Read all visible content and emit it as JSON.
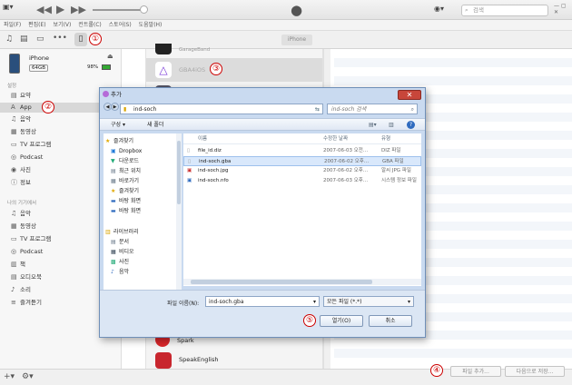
{
  "toolbar": {
    "search_placeholder": "검색"
  },
  "menubar": {
    "items": [
      "파일(F)",
      "편집(E)",
      "보기(V)",
      "컨트롤(C)",
      "스토어(S)",
      "도움말(H)"
    ]
  },
  "tabbar": {
    "device_tab": "iPhone",
    "annotation": "①"
  },
  "device": {
    "name": "iPhone",
    "capacity": "64GB",
    "battery": "98%"
  },
  "sidebar": {
    "settings_header": "설정",
    "settings_items": [
      "요약",
      "App",
      "음악",
      "동영상",
      "TV 프로그램",
      "Podcast",
      "사진",
      "정보"
    ],
    "device_header": "나의 기기에서",
    "device_items": [
      "음악",
      "동영상",
      "TV 프로그램",
      "Podcast",
      "책",
      "오디오북",
      "소리",
      "즐겨듣기"
    ],
    "annotation": "②"
  },
  "applist": {
    "top_cut": "GarageBand",
    "app1": "GBA4iOS",
    "app1_annotation": "③",
    "app2": "iMovePro",
    "bottom_items": [
      "Spark",
      "SpeakEnglish"
    ]
  },
  "dialog": {
    "title": "추가",
    "address": "ind-soch",
    "search_placeholder": "ind-soch 검색",
    "organize": "구성 ▾",
    "new_folder": "새 폴더",
    "nav": [
      {
        "icon": "★",
        "label": "즐겨찾기"
      },
      {
        "icon": "▣",
        "label": "Dropbox"
      },
      {
        "icon": "▼",
        "label": "다운로드"
      },
      {
        "icon": "▤",
        "label": "최근 위치"
      },
      {
        "icon": "▦",
        "label": "바로가기"
      },
      {
        "icon": "★",
        "label": "즐겨찾기"
      },
      {
        "icon": "▬",
        "label": "바탕 화면"
      },
      {
        "icon": "▬",
        "label": "바탕 화면"
      },
      {
        "icon": "▥",
        "label": "라이브러리"
      },
      {
        "icon": "▤",
        "label": "문서"
      },
      {
        "icon": "▦",
        "label": "비디오"
      },
      {
        "icon": "▩",
        "label": "사진"
      },
      {
        "icon": "♪",
        "label": "음악"
      }
    ],
    "columns": {
      "name": "이름",
      "date": "수정한 날짜",
      "type": "유형"
    },
    "files": [
      {
        "name": "file_id.diz",
        "date": "2007-06-03 오전...",
        "type": "DIZ 파일"
      },
      {
        "name": "ind-soch.gba",
        "date": "2007-06-02 오후...",
        "type": "GBA 파일"
      },
      {
        "name": "ind-soch.jpg",
        "date": "2007-06-02 오후...",
        "type": "알씨 JPG 파일"
      },
      {
        "name": "ind-soch.nfo",
        "date": "2007-06-03 오후...",
        "type": "시스템 정보 파일"
      }
    ],
    "filename_label": "파일 이름(N):",
    "filename_value": "ind-soch.gba",
    "filter": "모든 파일 (*.*)",
    "open": "열기(O)",
    "cancel": "취소",
    "annotation": "⑤"
  },
  "bottom": {
    "add_file": "파일 추가...",
    "save_as": "다음으로 저장...",
    "annotation": "④"
  }
}
